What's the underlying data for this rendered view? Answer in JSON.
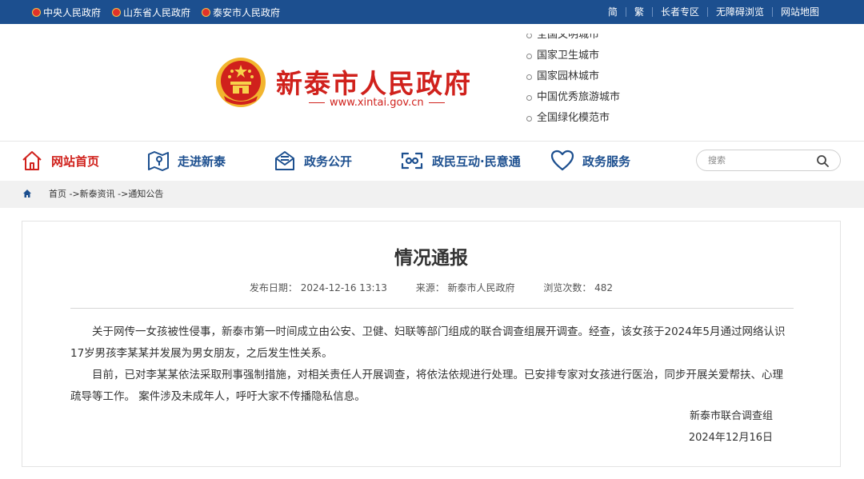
{
  "topbar": {
    "left_links": [
      "中央人民政府",
      "山东省人民政府",
      "泰安市人民政府"
    ],
    "right_links": [
      "简",
      "繁",
      "长者专区",
      "无障碍浏览",
      "网站地图"
    ]
  },
  "header": {
    "title": "新泰市人民政府",
    "url": "www.xintai.gov.cn",
    "honors": [
      "全国文明城市",
      "国家卫生城市",
      "国家园林城市",
      "中国优秀旅游城市",
      "全国绿化模范市"
    ]
  },
  "nav": {
    "items": [
      {
        "label": "网站首页",
        "icon": "home-icon"
      },
      {
        "label": "走进新泰",
        "icon": "map-pin-icon"
      },
      {
        "label": "政务公开",
        "icon": "mail-open-icon"
      },
      {
        "label": "政民互动·民意通",
        "icon": "interaction-icon"
      },
      {
        "label": "政务服务",
        "icon": "heart-icon"
      }
    ],
    "search_placeholder": "搜索"
  },
  "breadcrumb": {
    "path": "首页 ->新泰资讯 ->通知公告"
  },
  "article": {
    "title": "情况通报",
    "meta": {
      "date": "发布日期： 2024-12-16 13:13",
      "source": "来源： 新泰市人民政府",
      "views": "浏览次数： 482"
    },
    "paragraphs": [
      "关于网传一女孩被性侵事，新泰市第一时间成立由公安、卫健、妇联等部门组成的联合调查组展开调查。经查，该女孩于2024年5月通过网络认识17岁男孩李某某并发展为男女朋友，之后发生性关系。",
      "目前，已对李某某依法采取刑事强制措施，对相关责任人开展调查，将依法依规进行处理。已安排专家对女孩进行医治，同步开展关爱帮扶、心理疏导等工作。 案件涉及未成年人，呼吁大家不传播隐私信息。"
    ],
    "signature": "新泰市联合调查组",
    "sign_date": "2024年12月16日"
  },
  "colors": {
    "brand_blue": "#1c4f8f",
    "brand_red": "#d0211c"
  }
}
